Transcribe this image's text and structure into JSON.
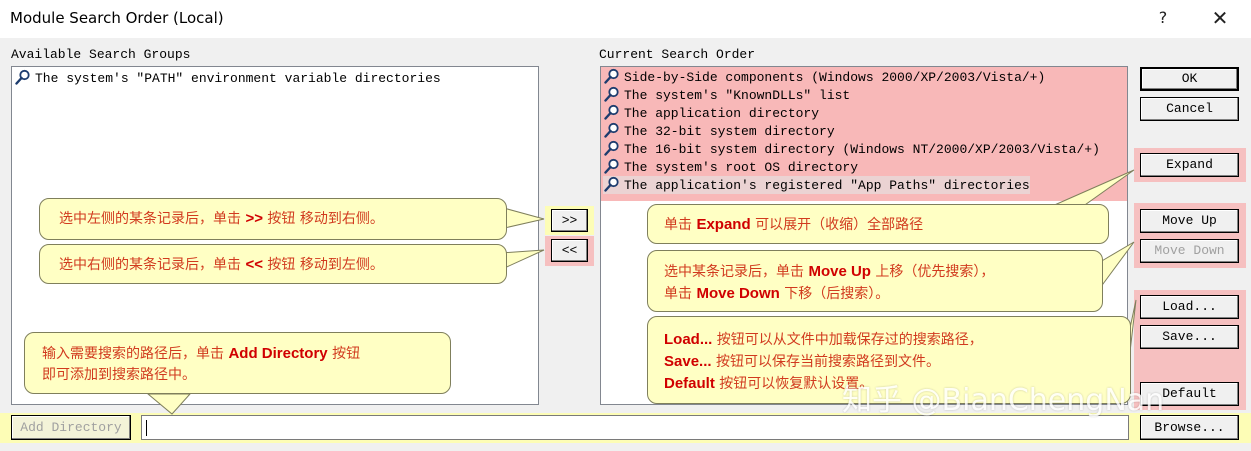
{
  "window": {
    "title": "Module Search Order (Local)",
    "help_label": "?",
    "close_label": "✕"
  },
  "available": {
    "label": "Available Search Groups",
    "items": [
      {
        "label": "The system's \"PATH\" environment variable directories"
      }
    ]
  },
  "current": {
    "label": "Current Search Order",
    "items": [
      {
        "label": "Side-by-Side components (Windows 2000/XP/2003/Vista/+)"
      },
      {
        "label": "The system's \"KnownDLLs\" list"
      },
      {
        "label": "The application directory"
      },
      {
        "label": "The 32-bit system directory"
      },
      {
        "label": "The 16-bit system directory (Windows NT/2000/XP/2003/Vista/+)"
      },
      {
        "label": "The system's root OS directory"
      },
      {
        "label": "The application's registered \"App Paths\" directories"
      }
    ]
  },
  "buttons": {
    "ok": "OK",
    "cancel": "Cancel",
    "expand": "Expand",
    "move_up": "Move Up",
    "move_down": "Move Down",
    "load": "Load...",
    "save": "Save...",
    "default": "Default",
    "add_right": ">>",
    "add_left": "<<",
    "add_directory": "Add Directory",
    "browse": "Browse..."
  },
  "path_input": {
    "value": ""
  },
  "annotations": {
    "move_right": {
      "pre": "选中左侧的某条记录后，单击 ",
      "key": ">>",
      "post": " 按钮 移动到右侧。"
    },
    "move_left": {
      "pre": "选中右侧的某条记录后，单击 ",
      "key": "<<",
      "post": " 按钮 移动到左侧。"
    },
    "add_dir": {
      "pre": "输入需要搜索的路径后，单击 ",
      "key": "Add Directory",
      "post": " 按钮",
      "line2": "即可添加到搜索路径中。"
    },
    "expand": {
      "pre": "单击 ",
      "key": "Expand",
      "post": " 可以展开（收缩）全部路径"
    },
    "move": {
      "pre1": "选中某条记录后，单击 ",
      "key1": "Move Up",
      "post1": " 上移（优先搜索），",
      "pre2": "单击 ",
      "key2": "Move Down",
      "post2": " 下移（后搜索）。"
    },
    "load_save": {
      "key1": "Load...",
      "post1": " 按钮可以从文件中加载保存过的搜索路径，",
      "key2": "Save...",
      "post2": " 按钮可以保存当前搜索路径到文件。",
      "key3": "Default",
      "post3": " 按钮可以恢复默认设置。"
    }
  },
  "watermark": "知乎 @BianChengNan",
  "colors": {
    "highlight": "#f8b8b8",
    "callout_bg": "#ffffc4",
    "callout_text": "#d13a1e",
    "key_text": "#d00000"
  },
  "icon_names": {
    "list_item": "search-folder-icon"
  }
}
